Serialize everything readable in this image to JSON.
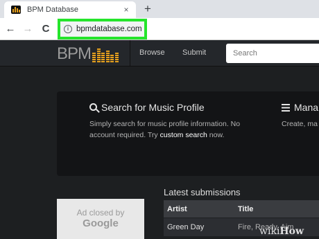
{
  "browser": {
    "tab_title": "BPM Database",
    "tab_close": "×",
    "new_tab": "+",
    "back": "←",
    "forward": "→",
    "reload": "C",
    "info": "i",
    "url": "bpmdatabase.com"
  },
  "site": {
    "logo_text": "BPM",
    "nav": {
      "browse": "Browse",
      "submit": "Submit"
    },
    "search_placeholder": "Search",
    "accent_color": "#e8a11c"
  },
  "cards": {
    "search": {
      "title": "Search for Music Profile",
      "text_before": "Simply search for music profile information. No account required. Try ",
      "link": "custom search",
      "text_after": " now."
    },
    "manage": {
      "title": "Mana",
      "text": "Create, ma"
    }
  },
  "ad": {
    "line1": "Ad closed by",
    "line2": "Google"
  },
  "latest": {
    "title": "Latest submissions",
    "columns": [
      "Artist",
      "Title"
    ],
    "rows": [
      {
        "artist": "Green Day",
        "title": "Fire, Ready, Aim"
      }
    ]
  },
  "watermark": {
    "wiki": "wiki",
    "how": "How"
  }
}
